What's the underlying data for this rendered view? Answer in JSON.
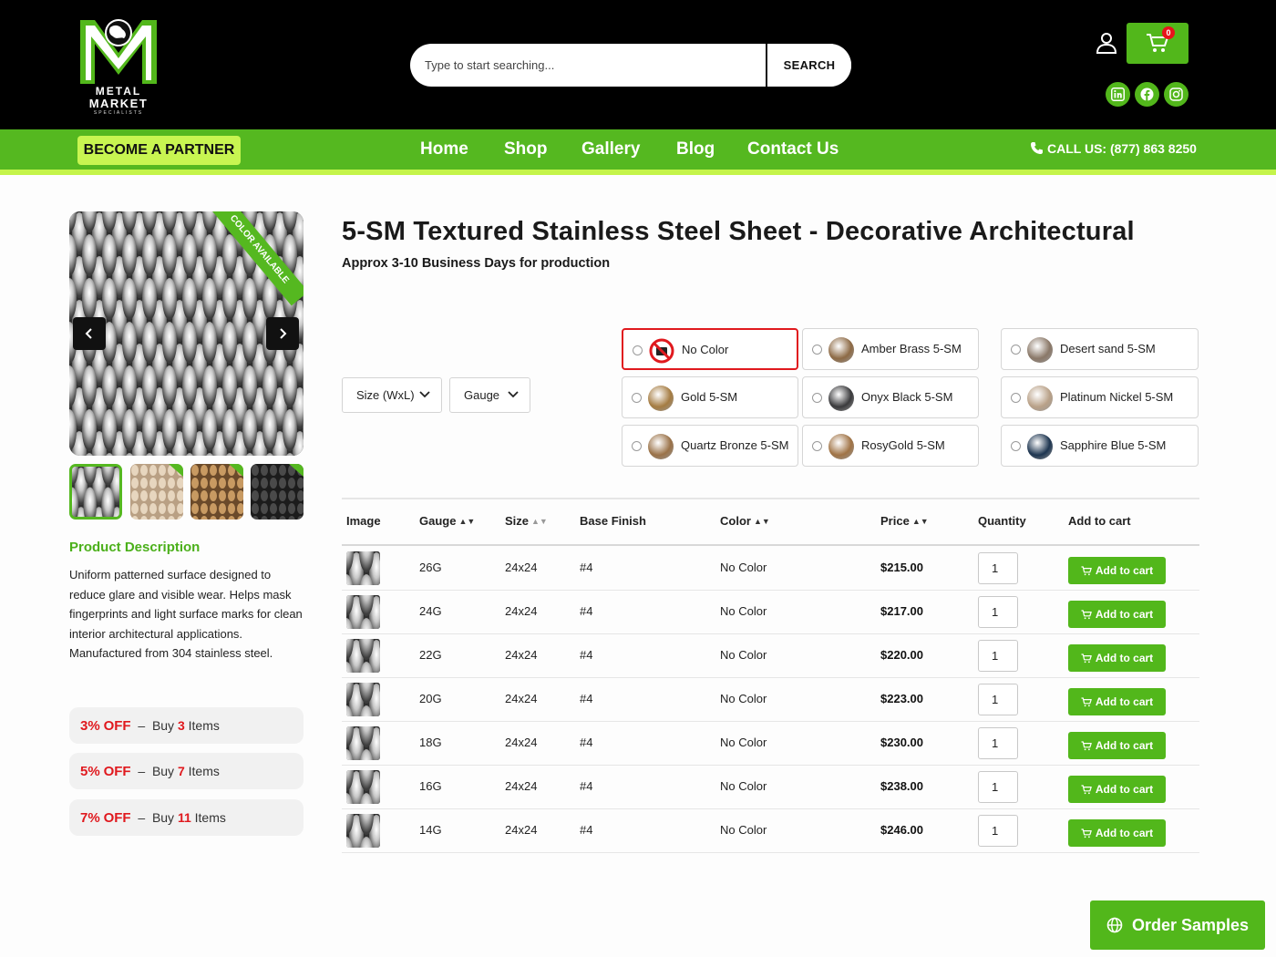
{
  "header": {
    "logo_word1": "METAL",
    "logo_word2": "MARKET",
    "logo_word3": "SPECIALISTS",
    "search_placeholder": "Type to start searching...",
    "search_button": "SEARCH",
    "cart_count": "0",
    "social_icons": [
      "linkedin-icon",
      "facebook-icon",
      "instagram-icon"
    ]
  },
  "nav": {
    "partner_label": "BECOME A PARTNER",
    "items": [
      "Home",
      "Shop",
      "Gallery",
      "Blog",
      "Contact Us"
    ],
    "call_label": "CALL US: (877) 863 8250"
  },
  "gallery": {
    "ribbon": "COLOR AVAILABLE",
    "thumb_count": 4
  },
  "description": {
    "title": "Product Description",
    "text": "Uniform patterned surface designed to reduce glare and visible wear. Helps mask fingerprints and light surface marks for clean interior architectural applications. Manufactured from 304 stainless steel."
  },
  "discounts": [
    {
      "pct": "3%",
      "off": "OFF",
      "sep": "–",
      "buy": "Buy",
      "qty": "3",
      "items": "Items"
    },
    {
      "pct": "5%",
      "off": "OFF",
      "sep": "–",
      "buy": "Buy",
      "qty": "7",
      "items": "Items"
    },
    {
      "pct": "7%",
      "off": "OFF",
      "sep": "–",
      "buy": "Buy",
      "qty": "11",
      "items": "Items"
    }
  ],
  "product": {
    "title": "5-SM Textured Stainless Steel Sheet - Decorative Architectural",
    "subtitle": "Approx 3-10 Business Days for production"
  },
  "filters": {
    "size_label": "Size (WxL)",
    "gauge_label": "Gauge"
  },
  "colors": [
    {
      "label": "No Color",
      "color": "#ffffff",
      "selected": true
    },
    {
      "label": "Amber Brass 5-SM",
      "color": "#8d6a45"
    },
    {
      "label": "Desert sand 5-SM",
      "color": "#8a7868"
    },
    {
      "label": "Gold 5-SM",
      "color": "#a57c42"
    },
    {
      "label": "Onyx Black 5-SM",
      "color": "#3a3a3c"
    },
    {
      "label": "Platinum Nickel 5-SM",
      "color": "#b9a188"
    },
    {
      "label": "Quartz Bronze 5-SM",
      "color": "#9a7248"
    },
    {
      "label": "RosyGold 5-SM",
      "color": "#a07345"
    },
    {
      "label": "Sapphire Blue 5-SM",
      "color": "#1d3550"
    }
  ],
  "table": {
    "headers": [
      "Image",
      "Gauge",
      "Size",
      "Base Finish",
      "Color",
      "Price",
      "Quantity",
      "Add to cart"
    ],
    "add_label": "Add to cart",
    "rows": [
      {
        "gauge": "26G",
        "size": "24x24",
        "finish": "#4",
        "color": "No Color",
        "price": "$215.00",
        "qty": "1"
      },
      {
        "gauge": "24G",
        "size": "24x24",
        "finish": "#4",
        "color": "No Color",
        "price": "$217.00",
        "qty": "1"
      },
      {
        "gauge": "22G",
        "size": "24x24",
        "finish": "#4",
        "color": "No Color",
        "price": "$220.00",
        "qty": "1"
      },
      {
        "gauge": "20G",
        "size": "24x24",
        "finish": "#4",
        "color": "No Color",
        "price": "$223.00",
        "qty": "1"
      },
      {
        "gauge": "18G",
        "size": "24x24",
        "finish": "#4",
        "color": "No Color",
        "price": "$230.00",
        "qty": "1"
      },
      {
        "gauge": "16G",
        "size": "24x24",
        "finish": "#4",
        "color": "No Color",
        "price": "$238.00",
        "qty": "1"
      },
      {
        "gauge": "14G",
        "size": "24x24",
        "finish": "#4",
        "color": "No Color",
        "price": "$246.00",
        "qty": "1"
      }
    ]
  },
  "order_samples": "Order Samples",
  "theme": {
    "green": "#52b71b",
    "lime": "#c8f551",
    "red": "#e0191e"
  }
}
